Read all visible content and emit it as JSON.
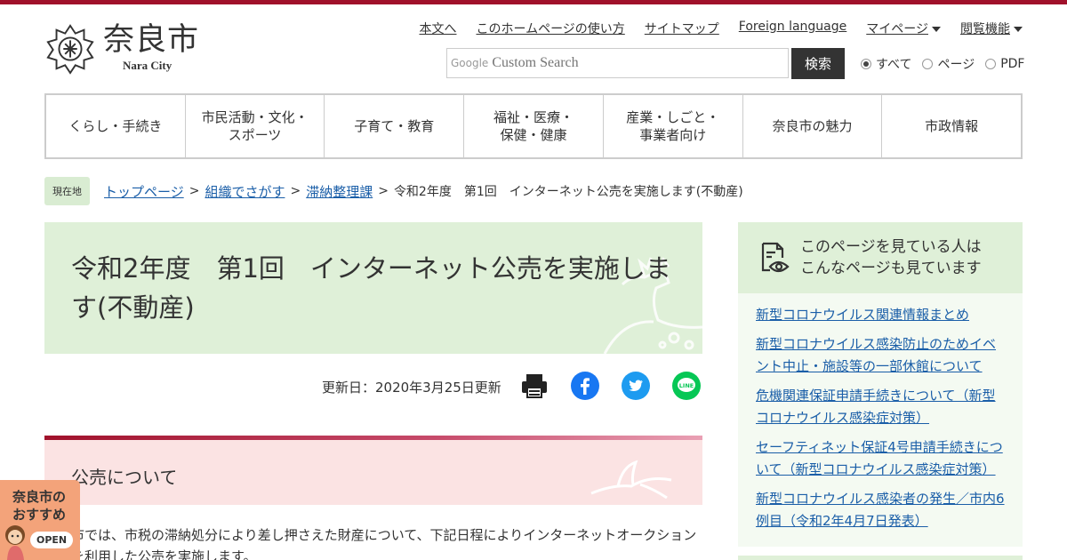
{
  "site": {
    "title": "奈良市",
    "subtitle": "Nara City"
  },
  "utility_nav": [
    {
      "label": "本文へ"
    },
    {
      "label": "このホームページの使い方"
    },
    {
      "label": "サイトマップ"
    },
    {
      "label": "Foreign language"
    },
    {
      "label": "マイページ"
    },
    {
      "label": "閲覧機能"
    }
  ],
  "search": {
    "brand": "Google",
    "placeholder": "Custom Search",
    "button": "検索",
    "scope": [
      "すべて",
      "ページ",
      "PDF"
    ],
    "selected": "すべて"
  },
  "main_nav": [
    "くらし・手続き",
    "市民活動・文化・\nスポーツ",
    "子育て・教育",
    "福祉・医療・\n保健・健康",
    "産業・しごと・\n事業者向け",
    "奈良市の魅力",
    "市政情報"
  ],
  "breadcrumb": {
    "badge": "現在地",
    "links": [
      "トップページ",
      "組織でさがす",
      "滞納整理課"
    ],
    "separator": ">",
    "current": "令和2年度　第1回　インターネット公売を実施します(不動産)"
  },
  "page": {
    "title": "令和2年度　第1回　インターネット公売を実施します(不動産)",
    "updated": "更新日：2020年3月25日更新",
    "section_heading": "公売について",
    "body": "市では、市税の滞納処分により差し押さえた財産について、下記日程によりインターネットオークションを利用した公売を実施します。"
  },
  "share_icons": [
    "print-icon",
    "facebook-icon",
    "twitter-icon",
    "line-icon"
  ],
  "sidebar": {
    "heading": "このページを見ている人は\nこんなページも見ています",
    "links": [
      "新型コロナウイルス関連情報まとめ",
      "新型コロナウイルス感染防止のためイベント中止・施設等の一部休館について",
      "危機関連保証申請手続きについて（新型コロナウイルス感染症対策）",
      "セーフティネット保証4号申請手続きについて（新型コロナウイルス感染症対策）",
      "新型コロナウイルス感染者の発生／市内6例目（令和2年4月7日発表）"
    ]
  },
  "recommend": {
    "label": "奈良市の\nおすすめ",
    "button": "OPEN"
  },
  "colors": {
    "brand": "#a0112b",
    "green_panel": "#dff0d8",
    "pink_panel": "#fbe3e3",
    "link": "#1a5ea8"
  }
}
